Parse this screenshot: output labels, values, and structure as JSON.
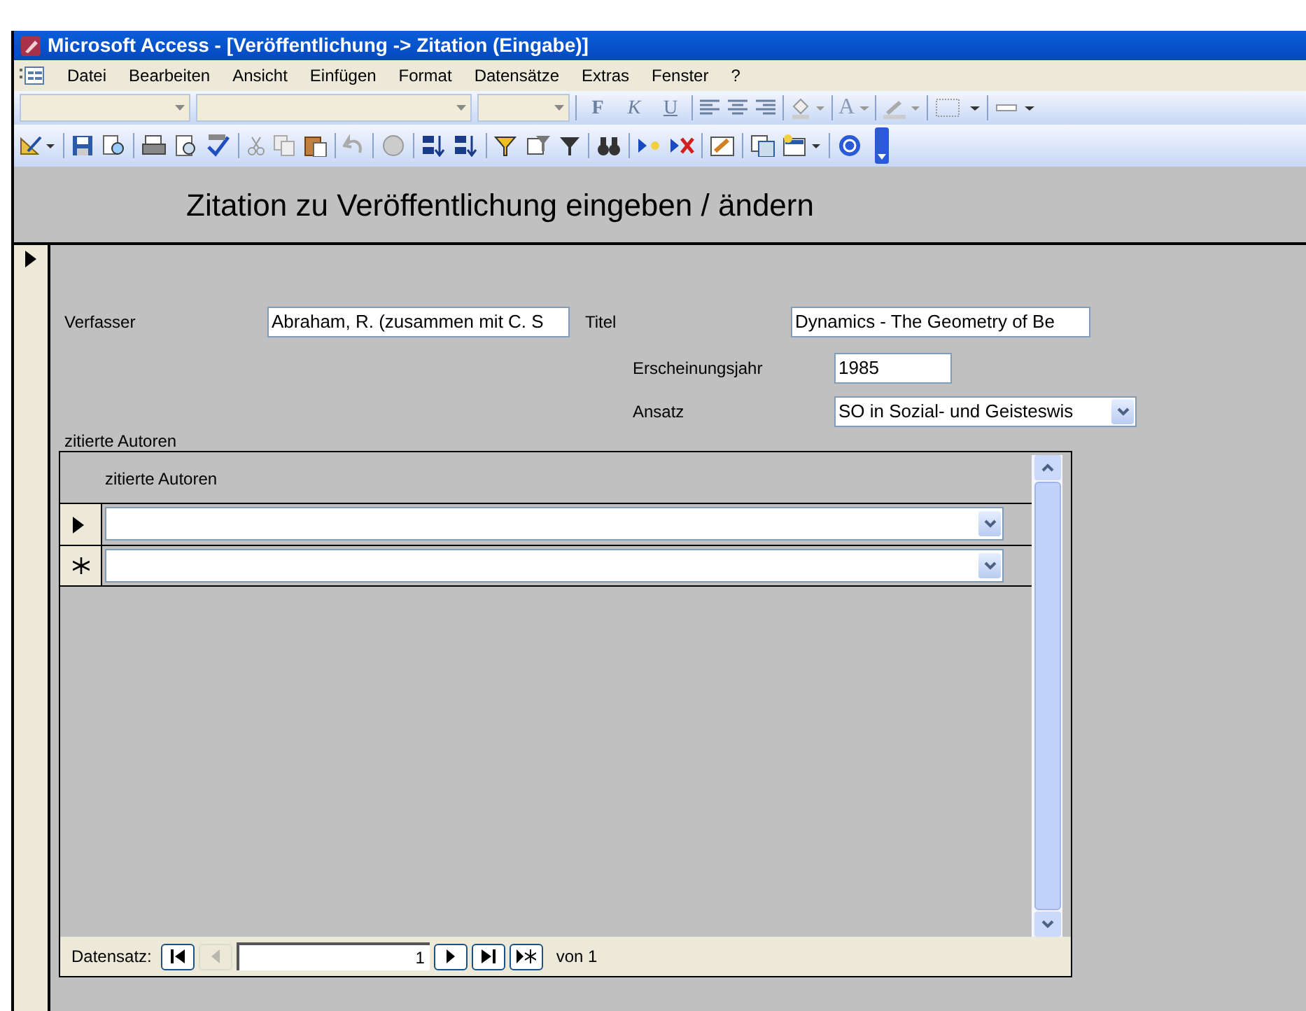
{
  "window": {
    "title": "Microsoft Access - [Veröffentlichung -> Zitation (Eingabe)]"
  },
  "menu": [
    {
      "label": "Datei"
    },
    {
      "label": "Bearbeiten"
    },
    {
      "label": "Ansicht"
    },
    {
      "label": "Einfügen"
    },
    {
      "label": "Format"
    },
    {
      "label": "Datensätze"
    },
    {
      "label": "Extras"
    },
    {
      "label": "Fenster"
    },
    {
      "label": "?"
    }
  ],
  "format_toolbar": {
    "style_buttons": [
      "F",
      "K",
      "U"
    ],
    "text_color_button": "A"
  },
  "form": {
    "header": "Zitation zu Veröffentlichung eingeben / ändern",
    "record_selector": {
      "current": true
    },
    "fields": [
      {
        "label": "Verfasser",
        "value": "Abraham, R. (zusammen mit C. S"
      },
      {
        "label": "Titel",
        "value": "Dynamics - The Geometry of Be"
      },
      {
        "label": "Erscheinungsjahr",
        "value": "1985"
      },
      {
        "label": "Ansatz",
        "value": "SO in Sozial- und Geisteswis",
        "kind": "dropdown"
      }
    ],
    "subform": {
      "label": "zitierte Autoren",
      "column_header": "zitierte Autoren",
      "rows": [
        {
          "kind": "current",
          "value": ""
        },
        {
          "kind": "new",
          "value": ""
        }
      ],
      "navigation": {
        "label": "Datensatz:",
        "record": "1",
        "of": "von 1",
        "first_disabled": false,
        "previous_disabled": true
      }
    }
  }
}
